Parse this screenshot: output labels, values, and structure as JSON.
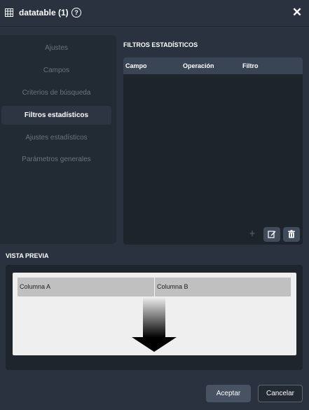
{
  "window": {
    "title": "datatable (1)",
    "help_glyph": "?",
    "close_glyph": "✕"
  },
  "sidebar": {
    "items": [
      {
        "label": "Ajustes",
        "active": false
      },
      {
        "label": "Campos",
        "active": false
      },
      {
        "label": "Criterios de búsqueda",
        "active": false
      },
      {
        "label": "Filtros estadísticos",
        "active": true
      },
      {
        "label": "Ajustes estadísticos",
        "active": false
      },
      {
        "label": "Parámetros generales",
        "active": false
      }
    ]
  },
  "filters": {
    "section_title": "FILTROS ESTADÍSTICOS",
    "columns": [
      "Campo",
      "Operación",
      "Filtro"
    ],
    "rows": [],
    "add_glyph": "+"
  },
  "preview": {
    "section_title": "VISTA PREVIA",
    "columns": [
      "Columna A",
      "Columna B"
    ]
  },
  "footer": {
    "accept_label": "Aceptar",
    "cancel_label": "Cancelar"
  },
  "colors": {
    "background": "#2a3240",
    "panel": "#1d242c",
    "header": "#394454",
    "button": "#475262"
  },
  "icons": [
    "table-icon",
    "help-icon",
    "close-icon",
    "plus-icon",
    "edit-icon",
    "trash-icon",
    "down-arrow-icon"
  ]
}
